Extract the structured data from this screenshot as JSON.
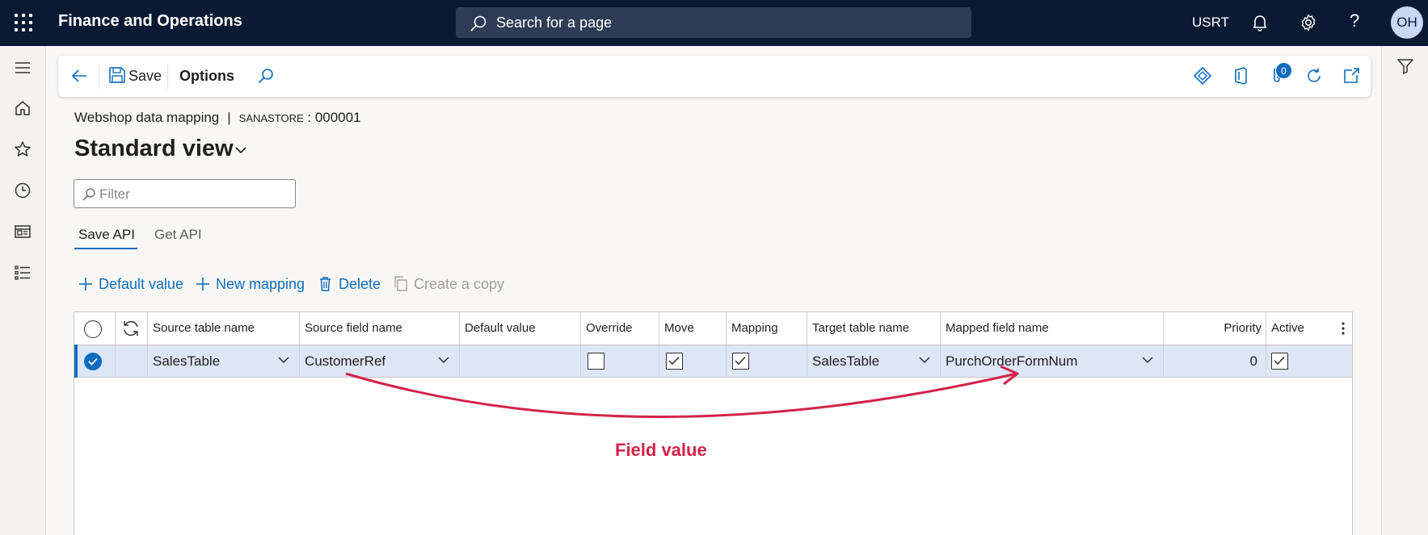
{
  "header": {
    "app_title": "Finance and Operations",
    "search_placeholder": "Search for a page",
    "company": "USRT",
    "help_glyph": "?",
    "avatar_initials": "OH"
  },
  "left_nav": {
    "icons": [
      "hamburger-icon",
      "home-icon",
      "star-icon",
      "clock-icon",
      "workspace-icon",
      "list-icon"
    ]
  },
  "action_pane": {
    "save_label": "Save",
    "options_label": "Options",
    "attachments_count": "0"
  },
  "page": {
    "breadcrumb_form": "Webshop data mapping",
    "breadcrumb_separator": "|",
    "breadcrumb_company": "SANASTORE",
    "breadcrumb_record": ": 000001",
    "view_title": "Standard view",
    "filter_placeholder": "Filter"
  },
  "tabs": [
    {
      "label": "Save API",
      "active": true
    },
    {
      "label": "Get API",
      "active": false
    }
  ],
  "grid_toolbar": {
    "default_value": "Default value",
    "new_mapping": "New mapping",
    "delete": "Delete",
    "create_copy": "Create a copy"
  },
  "grid": {
    "columns": {
      "source_table": "Source table name",
      "source_field": "Source field name",
      "default_value": "Default value",
      "override": "Override",
      "move": "Move",
      "mapping": "Mapping",
      "target_table": "Target table name",
      "mapped_field": "Mapped field name",
      "priority": "Priority",
      "active": "Active"
    },
    "rows": [
      {
        "selected": true,
        "source_table": "SalesTable",
        "source_field": "CustomerRef",
        "default_value": "",
        "override": false,
        "move": true,
        "mapping": true,
        "target_table": "SalesTable",
        "mapped_field": "PurchOrderFormNum",
        "priority": "0",
        "active": true
      }
    ]
  },
  "annotation": {
    "label": "Field value",
    "color": "#d2234a"
  },
  "colors": {
    "topbar": "#0b1a33",
    "accent": "#0f6cbd",
    "selected_row": "#dce6f7"
  }
}
